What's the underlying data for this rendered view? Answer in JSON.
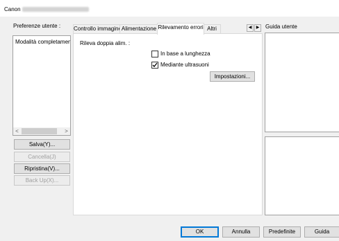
{
  "window": {
    "title_app": "Canon"
  },
  "preferences": {
    "label": "Preferenze utente :",
    "selected_item": "Modalità completamente",
    "buttons": {
      "save": "Salva(Y)...",
      "delete": "Cancella(J)",
      "restore": "Ripristina(V)...",
      "backup": "Back Up(X)..."
    }
  },
  "tabs": [
    {
      "label": "Controllo immagine"
    },
    {
      "label": "Alimentazione"
    },
    {
      "label": "Rilevamento errori",
      "active": true
    },
    {
      "label": "Altri"
    }
  ],
  "panel": {
    "double_feed_label": "Rileva doppia alim. :",
    "option_length": {
      "label": "In base a lunghezza",
      "checked": false
    },
    "option_ultrasonic": {
      "label": "Mediante ultrasuoni",
      "checked": true
    },
    "settings_button": "Impostazioni..."
  },
  "guide": {
    "label": "Guida utente"
  },
  "footer": {
    "ok": "OK",
    "cancel": "Annulla",
    "defaults": "Predefinite",
    "help": "Guida"
  }
}
